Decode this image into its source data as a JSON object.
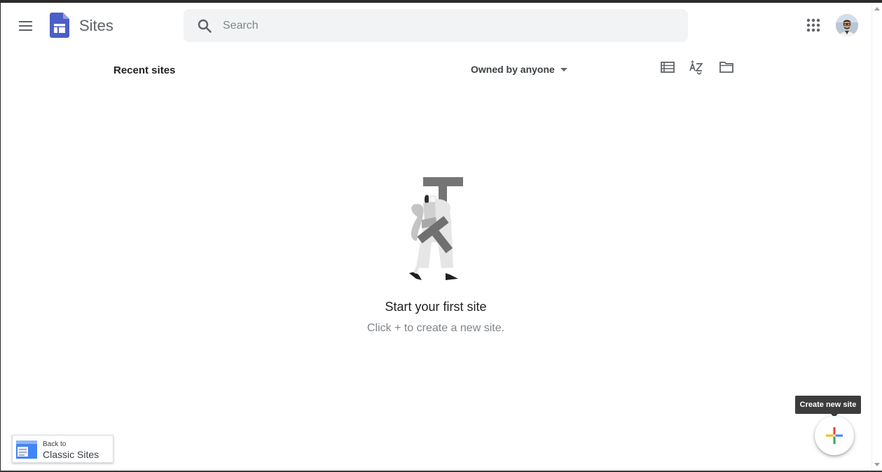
{
  "header": {
    "app_title": "Sites",
    "search_placeholder": "Search"
  },
  "toolbar": {
    "section_title": "Recent sites",
    "owner_filter": "Owned by anyone"
  },
  "empty_state": {
    "title": "Start your first site",
    "subtitle": "Click + to create a new site."
  },
  "classic": {
    "small_label": "Back to",
    "big_label": "Classic Sites"
  },
  "fab": {
    "tooltip": "Create new site"
  },
  "icons": {
    "menu": "menu-icon",
    "logo": "sites-logo-icon",
    "search": "search-icon",
    "apps": "apps-grid-icon",
    "list_view": "list-view-icon",
    "sort": "sort-az-icon",
    "folder": "folder-icon",
    "plus": "plus-icon"
  },
  "colors": {
    "brand": "#4b5fc8",
    "plus_red": "#ea4335",
    "plus_blue": "#4285f4",
    "plus_yellow": "#fbbc04",
    "plus_green": "#34a853"
  }
}
